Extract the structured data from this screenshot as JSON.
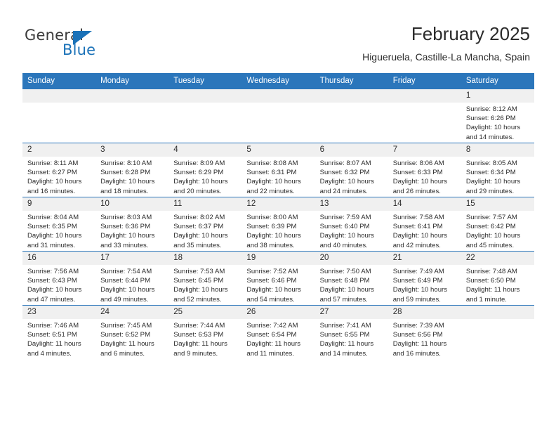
{
  "brand": {
    "name_part1": "General",
    "name_part2": "Blue",
    "accent_color": "#1b72b8"
  },
  "header": {
    "title": "February 2025",
    "subtitle": "Higueruela, Castille-La Mancha, Spain"
  },
  "colors": {
    "header_bar": "#2b76bb",
    "daynum_band": "#f0f0f0",
    "text": "#2b2b2b"
  },
  "weekdays": [
    "Sunday",
    "Monday",
    "Tuesday",
    "Wednesday",
    "Thursday",
    "Friday",
    "Saturday"
  ],
  "weeks": [
    [
      {
        "day": "",
        "sunrise": "",
        "sunset": "",
        "daylight": "",
        "empty": true
      },
      {
        "day": "",
        "sunrise": "",
        "sunset": "",
        "daylight": "",
        "empty": true
      },
      {
        "day": "",
        "sunrise": "",
        "sunset": "",
        "daylight": "",
        "empty": true
      },
      {
        "day": "",
        "sunrise": "",
        "sunset": "",
        "daylight": "",
        "empty": true
      },
      {
        "day": "",
        "sunrise": "",
        "sunset": "",
        "daylight": "",
        "empty": true
      },
      {
        "day": "",
        "sunrise": "",
        "sunset": "",
        "daylight": "",
        "empty": true
      },
      {
        "day": "1",
        "sunrise": "Sunrise: 8:12 AM",
        "sunset": "Sunset: 6:26 PM",
        "daylight": "Daylight: 10 hours and 14 minutes."
      }
    ],
    [
      {
        "day": "2",
        "sunrise": "Sunrise: 8:11 AM",
        "sunset": "Sunset: 6:27 PM",
        "daylight": "Daylight: 10 hours and 16 minutes."
      },
      {
        "day": "3",
        "sunrise": "Sunrise: 8:10 AM",
        "sunset": "Sunset: 6:28 PM",
        "daylight": "Daylight: 10 hours and 18 minutes."
      },
      {
        "day": "4",
        "sunrise": "Sunrise: 8:09 AM",
        "sunset": "Sunset: 6:29 PM",
        "daylight": "Daylight: 10 hours and 20 minutes."
      },
      {
        "day": "5",
        "sunrise": "Sunrise: 8:08 AM",
        "sunset": "Sunset: 6:31 PM",
        "daylight": "Daylight: 10 hours and 22 minutes."
      },
      {
        "day": "6",
        "sunrise": "Sunrise: 8:07 AM",
        "sunset": "Sunset: 6:32 PM",
        "daylight": "Daylight: 10 hours and 24 minutes."
      },
      {
        "day": "7",
        "sunrise": "Sunrise: 8:06 AM",
        "sunset": "Sunset: 6:33 PM",
        "daylight": "Daylight: 10 hours and 26 minutes."
      },
      {
        "day": "8",
        "sunrise": "Sunrise: 8:05 AM",
        "sunset": "Sunset: 6:34 PM",
        "daylight": "Daylight: 10 hours and 29 minutes."
      }
    ],
    [
      {
        "day": "9",
        "sunrise": "Sunrise: 8:04 AM",
        "sunset": "Sunset: 6:35 PM",
        "daylight": "Daylight: 10 hours and 31 minutes."
      },
      {
        "day": "10",
        "sunrise": "Sunrise: 8:03 AM",
        "sunset": "Sunset: 6:36 PM",
        "daylight": "Daylight: 10 hours and 33 minutes."
      },
      {
        "day": "11",
        "sunrise": "Sunrise: 8:02 AM",
        "sunset": "Sunset: 6:37 PM",
        "daylight": "Daylight: 10 hours and 35 minutes."
      },
      {
        "day": "12",
        "sunrise": "Sunrise: 8:00 AM",
        "sunset": "Sunset: 6:39 PM",
        "daylight": "Daylight: 10 hours and 38 minutes."
      },
      {
        "day": "13",
        "sunrise": "Sunrise: 7:59 AM",
        "sunset": "Sunset: 6:40 PM",
        "daylight": "Daylight: 10 hours and 40 minutes."
      },
      {
        "day": "14",
        "sunrise": "Sunrise: 7:58 AM",
        "sunset": "Sunset: 6:41 PM",
        "daylight": "Daylight: 10 hours and 42 minutes."
      },
      {
        "day": "15",
        "sunrise": "Sunrise: 7:57 AM",
        "sunset": "Sunset: 6:42 PM",
        "daylight": "Daylight: 10 hours and 45 minutes."
      }
    ],
    [
      {
        "day": "16",
        "sunrise": "Sunrise: 7:56 AM",
        "sunset": "Sunset: 6:43 PM",
        "daylight": "Daylight: 10 hours and 47 minutes."
      },
      {
        "day": "17",
        "sunrise": "Sunrise: 7:54 AM",
        "sunset": "Sunset: 6:44 PM",
        "daylight": "Daylight: 10 hours and 49 minutes."
      },
      {
        "day": "18",
        "sunrise": "Sunrise: 7:53 AM",
        "sunset": "Sunset: 6:45 PM",
        "daylight": "Daylight: 10 hours and 52 minutes."
      },
      {
        "day": "19",
        "sunrise": "Sunrise: 7:52 AM",
        "sunset": "Sunset: 6:46 PM",
        "daylight": "Daylight: 10 hours and 54 minutes."
      },
      {
        "day": "20",
        "sunrise": "Sunrise: 7:50 AM",
        "sunset": "Sunset: 6:48 PM",
        "daylight": "Daylight: 10 hours and 57 minutes."
      },
      {
        "day": "21",
        "sunrise": "Sunrise: 7:49 AM",
        "sunset": "Sunset: 6:49 PM",
        "daylight": "Daylight: 10 hours and 59 minutes."
      },
      {
        "day": "22",
        "sunrise": "Sunrise: 7:48 AM",
        "sunset": "Sunset: 6:50 PM",
        "daylight": "Daylight: 11 hours and 1 minute."
      }
    ],
    [
      {
        "day": "23",
        "sunrise": "Sunrise: 7:46 AM",
        "sunset": "Sunset: 6:51 PM",
        "daylight": "Daylight: 11 hours and 4 minutes."
      },
      {
        "day": "24",
        "sunrise": "Sunrise: 7:45 AM",
        "sunset": "Sunset: 6:52 PM",
        "daylight": "Daylight: 11 hours and 6 minutes."
      },
      {
        "day": "25",
        "sunrise": "Sunrise: 7:44 AM",
        "sunset": "Sunset: 6:53 PM",
        "daylight": "Daylight: 11 hours and 9 minutes."
      },
      {
        "day": "26",
        "sunrise": "Sunrise: 7:42 AM",
        "sunset": "Sunset: 6:54 PM",
        "daylight": "Daylight: 11 hours and 11 minutes."
      },
      {
        "day": "27",
        "sunrise": "Sunrise: 7:41 AM",
        "sunset": "Sunset: 6:55 PM",
        "daylight": "Daylight: 11 hours and 14 minutes."
      },
      {
        "day": "28",
        "sunrise": "Sunrise: 7:39 AM",
        "sunset": "Sunset: 6:56 PM",
        "daylight": "Daylight: 11 hours and 16 minutes."
      },
      {
        "day": "",
        "sunrise": "",
        "sunset": "",
        "daylight": "",
        "empty": true
      }
    ]
  ]
}
